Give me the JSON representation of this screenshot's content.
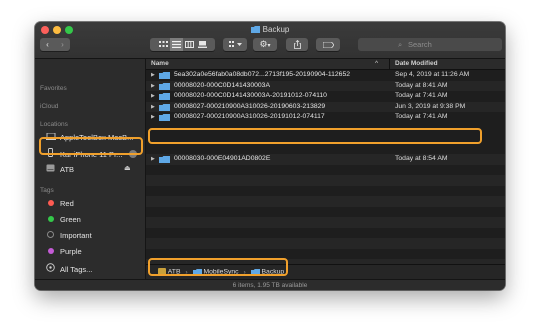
{
  "window": {
    "title": "Backup"
  },
  "toolbar": {
    "back_label": "‹",
    "forward_label": "›",
    "search_placeholder": "Search"
  },
  "sidebar": {
    "favorites_label": "Favorites",
    "icloud_label": "iCloud",
    "locations_label": "Locations",
    "locations": [
      {
        "label": "AppleToolBox MacB..."
      },
      {
        "label": "Kar iPhone 11 Pr..."
      },
      {
        "label": "ATB"
      }
    ],
    "tags_label": "Tags",
    "tags": [
      {
        "label": "Red",
        "color": "#ff5b52"
      },
      {
        "label": "Green",
        "color": "#34c84a"
      },
      {
        "label": "Important",
        "color": "#2a2a2a"
      },
      {
        "label": "Purple",
        "color": "#c45bd6"
      },
      {
        "label": "All Tags..."
      }
    ]
  },
  "columns": {
    "name": "Name",
    "date": "Date Modified"
  },
  "files": [
    {
      "name": "5ea302a0e56fab0a08db072...2713f195-20190904-112652",
      "date": "Sep 4, 2019 at 11:26 AM"
    },
    {
      "name": "00008020-000C0D141430003A",
      "date": "Today at 8:41 AM"
    },
    {
      "name": "00008020-000C0D141430003A-20191012-074110",
      "date": "Today at 7:41 AM"
    },
    {
      "name": "00008027-000210900A310026-20190603-213829",
      "date": "Jun 3, 2019 at 9:38 PM"
    },
    {
      "name": "00008027-000210900A310026-20191012-074117",
      "date": "Today at 7:41 AM"
    },
    {
      "name": "00008030-000E04901AD0802E",
      "date": "Today at 8:54 AM"
    }
  ],
  "pathbar": {
    "items": [
      "ATB",
      "MobileSync",
      "Backup"
    ]
  },
  "status": "6 items, 1.95 TB available",
  "colors": {
    "highlight": "#f0a02c",
    "folder": "#5fa8e6"
  }
}
